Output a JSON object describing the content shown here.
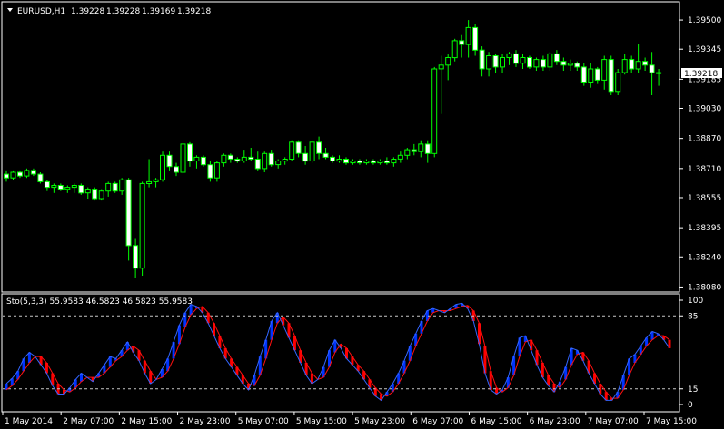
{
  "symbol_label": "EURUSD,H1",
  "ohlc": {
    "open": "1.39228",
    "high": "1.39228",
    "low": "1.39169",
    "close": "1.39218"
  },
  "current_price": "1.39218",
  "indicator_label": "Sto(5,3,3) 55.9583 46.5823 46.5823 55.9583",
  "colors": {
    "background": "#000000",
    "frame": "#ffffff",
    "bull_candle_fill": "#000000",
    "bear_candle_fill": "#ffffff",
    "candle_outline": "#00ff00",
    "bid_line": "#b4b4b4",
    "stoch_main": "#3366ff",
    "stoch_signal": "#ff1010",
    "stoch_hist_up": "#0033ff",
    "stoch_hist_down": "#ff0000",
    "level_line": "#c8c8c8"
  },
  "chart_data": [
    {
      "type": "candlestick",
      "price_axis_ticks": [
        "1.39500",
        "1.39345",
        "1.39185",
        "1.39030",
        "1.38870",
        "1.38710",
        "1.38555",
        "1.38395",
        "1.38240",
        "1.38080"
      ],
      "price_axis_values": [
        1.395,
        1.39345,
        1.39185,
        1.3903,
        1.3887,
        1.3871,
        1.38555,
        1.38395,
        1.3824,
        1.3808
      ],
      "ylim": [
        1.38058,
        1.39592
      ],
      "time_axis_labels": [
        "1 May 2014",
        "2 May 07:00",
        "2 May 15:00",
        "2 May 23:00",
        "5 May 07:00",
        "5 May 15:00",
        "5 May 23:00",
        "6 May 07:00",
        "6 May 15:00",
        "6 May 23:00",
        "7 May 07:00",
        "7 May 15:00"
      ],
      "current_price_value": 1.39218,
      "candles": [
        [
          1.3868,
          1.387,
          1.3864,
          1.3866
        ],
        [
          1.3866,
          1.387,
          1.3865,
          1.3869
        ],
        [
          1.3869,
          1.387,
          1.3866,
          1.3867
        ],
        [
          1.3867,
          1.3871,
          1.3866,
          1.387
        ],
        [
          1.387,
          1.3871,
          1.3867,
          1.3868
        ],
        [
          1.3868,
          1.3869,
          1.3863,
          1.3864
        ],
        [
          1.3864,
          1.3865,
          1.3859,
          1.3861
        ],
        [
          1.3861,
          1.3863,
          1.3858,
          1.3862
        ],
        [
          1.3862,
          1.3863,
          1.3859,
          1.386
        ],
        [
          1.386,
          1.3862,
          1.3858,
          1.3861
        ],
        [
          1.3861,
          1.3863,
          1.3858,
          1.3862
        ],
        [
          1.3862,
          1.3863,
          1.3857,
          1.3858
        ],
        [
          1.3858,
          1.3861,
          1.3855,
          1.386
        ],
        [
          1.386,
          1.3861,
          1.3854,
          1.3855
        ],
        [
          1.3855,
          1.386,
          1.3854,
          1.3859
        ],
        [
          1.3859,
          1.3864,
          1.3856,
          1.3863
        ],
        [
          1.3863,
          1.3864,
          1.3858,
          1.3859
        ],
        [
          1.3859,
          1.3866,
          1.3857,
          1.3865
        ],
        [
          1.3865,
          1.3866,
          1.3822,
          1.383
        ],
        [
          1.383,
          1.3834,
          1.3813,
          1.3818
        ],
        [
          1.3818,
          1.3864,
          1.3814,
          1.3863
        ],
        [
          1.3863,
          1.3876,
          1.3861,
          1.3864
        ],
        [
          1.3864,
          1.3866,
          1.3861,
          1.3865
        ],
        [
          1.3865,
          1.388,
          1.3864,
          1.3878
        ],
        [
          1.3878,
          1.388,
          1.387,
          1.3872
        ],
        [
          1.3872,
          1.3874,
          1.3867,
          1.3869
        ],
        [
          1.3869,
          1.3885,
          1.3868,
          1.3884
        ],
        [
          1.3884,
          1.3885,
          1.3872,
          1.3875
        ],
        [
          1.3875,
          1.3878,
          1.3871,
          1.3877
        ],
        [
          1.3877,
          1.3878,
          1.3872,
          1.3873
        ],
        [
          1.3873,
          1.3875,
          1.3864,
          1.3866
        ],
        [
          1.3866,
          1.3875,
          1.3864,
          1.3874
        ],
        [
          1.3874,
          1.3879,
          1.3872,
          1.3878
        ],
        [
          1.3878,
          1.3879,
          1.3874,
          1.3876
        ],
        [
          1.3876,
          1.3877,
          1.3874,
          1.3875
        ],
        [
          1.3875,
          1.3881,
          1.3874,
          1.3877
        ],
        [
          1.3877,
          1.3882,
          1.3875,
          1.3876
        ],
        [
          1.3876,
          1.388,
          1.387,
          1.3871
        ],
        [
          1.3871,
          1.388,
          1.3869,
          1.3879
        ],
        [
          1.3879,
          1.3881,
          1.3872,
          1.3873
        ],
        [
          1.3873,
          1.3876,
          1.3871,
          1.3875
        ],
        [
          1.3875,
          1.3877,
          1.3873,
          1.3876
        ],
        [
          1.3876,
          1.3886,
          1.3875,
          1.3885
        ],
        [
          1.3885,
          1.3886,
          1.3877,
          1.3879
        ],
        [
          1.3879,
          1.3883,
          1.3873,
          1.3875
        ],
        [
          1.3875,
          1.3886,
          1.3874,
          1.3885
        ],
        [
          1.3885,
          1.3888,
          1.3876,
          1.3879
        ],
        [
          1.3879,
          1.3882,
          1.3876,
          1.3877
        ],
        [
          1.3877,
          1.3878,
          1.3874,
          1.3875
        ],
        [
          1.3875,
          1.3878,
          1.3874,
          1.3876
        ],
        [
          1.3876,
          1.3877,
          1.3873,
          1.3874
        ],
        [
          1.3874,
          1.3876,
          1.3873,
          1.3875
        ],
        [
          1.3875,
          1.3876,
          1.3873,
          1.3874
        ],
        [
          1.3874,
          1.3876,
          1.3873,
          1.3875
        ],
        [
          1.3875,
          1.3876,
          1.3873,
          1.3874
        ],
        [
          1.3874,
          1.3876,
          1.3873,
          1.3875
        ],
        [
          1.3875,
          1.3877,
          1.3873,
          1.3874
        ],
        [
          1.3874,
          1.3877,
          1.3872,
          1.3876
        ],
        [
          1.3876,
          1.388,
          1.3874,
          1.3878
        ],
        [
          1.3878,
          1.3882,
          1.3876,
          1.3881
        ],
        [
          1.3881,
          1.3884,
          1.3878,
          1.388
        ],
        [
          1.388,
          1.3886,
          1.3877,
          1.3884
        ],
        [
          1.3884,
          1.3886,
          1.3874,
          1.3879
        ],
        [
          1.3879,
          1.3925,
          1.3877,
          1.3924
        ],
        [
          1.3924,
          1.3931,
          1.39,
          1.3926
        ],
        [
          1.3926,
          1.3932,
          1.3918,
          1.393
        ],
        [
          1.393,
          1.394,
          1.3928,
          1.3939
        ],
        [
          1.3939,
          1.3942,
          1.393,
          1.3937
        ],
        [
          1.3937,
          1.395,
          1.393,
          1.3946
        ],
        [
          1.3946,
          1.3948,
          1.3931,
          1.3934
        ],
        [
          1.3934,
          1.3936,
          1.392,
          1.3924
        ],
        [
          1.3924,
          1.3933,
          1.392,
          1.3931
        ],
        [
          1.3931,
          1.3932,
          1.3922,
          1.3925
        ],
        [
          1.3925,
          1.3932,
          1.3922,
          1.393
        ],
        [
          1.393,
          1.3933,
          1.3926,
          1.3932
        ],
        [
          1.3932,
          1.3934,
          1.3925,
          1.3927
        ],
        [
          1.3927,
          1.3932,
          1.3924,
          1.393
        ],
        [
          1.393,
          1.3931,
          1.3924,
          1.3925
        ],
        [
          1.3925,
          1.393,
          1.3923,
          1.3929
        ],
        [
          1.3929,
          1.3931,
          1.3923,
          1.3925
        ],
        [
          1.3925,
          1.3933,
          1.3923,
          1.3932
        ],
        [
          1.3932,
          1.3934,
          1.3926,
          1.3928
        ],
        [
          1.3928,
          1.393,
          1.3923,
          1.3926
        ],
        [
          1.3926,
          1.3929,
          1.3923,
          1.3927
        ],
        [
          1.3927,
          1.3928,
          1.3923,
          1.3925
        ],
        [
          1.3925,
          1.3927,
          1.3915,
          1.3917
        ],
        [
          1.3917,
          1.3927,
          1.3914,
          1.3924
        ],
        [
          1.3924,
          1.3925,
          1.3916,
          1.3918
        ],
        [
          1.3918,
          1.3931,
          1.3913,
          1.3929
        ],
        [
          1.3929,
          1.3931,
          1.391,
          1.3912
        ],
        [
          1.3912,
          1.3924,
          1.391,
          1.3922
        ],
        [
          1.3922,
          1.3932,
          1.3921,
          1.3929
        ],
        [
          1.3929,
          1.3931,
          1.3922,
          1.3924
        ],
        [
          1.3924,
          1.3937,
          1.3922,
          1.3928
        ],
        [
          1.3928,
          1.393,
          1.3923,
          1.3926
        ],
        [
          1.3926,
          1.3933,
          1.391,
          1.3922
        ],
        [
          1.3922,
          1.3924,
          1.3915,
          1.3922
        ]
      ]
    },
    {
      "type": "line",
      "levels_labels": [
        "100",
        "85",
        "15",
        "0"
      ],
      "levels": [
        100,
        85,
        15,
        0
      ],
      "ylim": [
        0,
        100
      ],
      "main": [
        20,
        25,
        32,
        44,
        50,
        46,
        38,
        30,
        18,
        10,
        10,
        16,
        24,
        30,
        26,
        22,
        30,
        38,
        46,
        44,
        52,
        60,
        50,
        42,
        30,
        20,
        24,
        34,
        44,
        60,
        76,
        88,
        96,
        94,
        88,
        78,
        66,
        54,
        44,
        36,
        28,
        20,
        14,
        28,
        46,
        62,
        80,
        88,
        76,
        64,
        52,
        40,
        28,
        20,
        24,
        36,
        52,
        62,
        54,
        44,
        38,
        32,
        24,
        16,
        8,
        4,
        12,
        20,
        30,
        42,
        56,
        68,
        80,
        90,
        92,
        90,
        88,
        92,
        96,
        97,
        92,
        80,
        58,
        30,
        14,
        10,
        14,
        26,
        46,
        64,
        66,
        52,
        38,
        26,
        18,
        12,
        22,
        36,
        54,
        52,
        42,
        30,
        20,
        10,
        4,
        4,
        12,
        28,
        44,
        48,
        56,
        64,
        70,
        68,
        62,
        54
      ],
      "signal": [
        14,
        18,
        24,
        32,
        40,
        46,
        46,
        40,
        30,
        20,
        14,
        12,
        16,
        22,
        26,
        26,
        26,
        30,
        36,
        42,
        46,
        52,
        56,
        52,
        42,
        32,
        24,
        26,
        32,
        44,
        58,
        74,
        86,
        92,
        94,
        88,
        78,
        66,
        54,
        44,
        36,
        28,
        20,
        18,
        28,
        44,
        62,
        78,
        84,
        78,
        66,
        52,
        40,
        30,
        24,
        26,
        36,
        50,
        58,
        54,
        46,
        38,
        32,
        24,
        16,
        10,
        8,
        12,
        20,
        30,
        42,
        56,
        68,
        80,
        88,
        90,
        90,
        90,
        92,
        94,
        95,
        90,
        78,
        56,
        32,
        16,
        12,
        16,
        28,
        46,
        60,
        62,
        52,
        40,
        28,
        20,
        16,
        24,
        38,
        48,
        50,
        42,
        30,
        20,
        12,
        6,
        6,
        14,
        28,
        40,
        48,
        56,
        62,
        66,
        66,
        62
      ]
    }
  ]
}
